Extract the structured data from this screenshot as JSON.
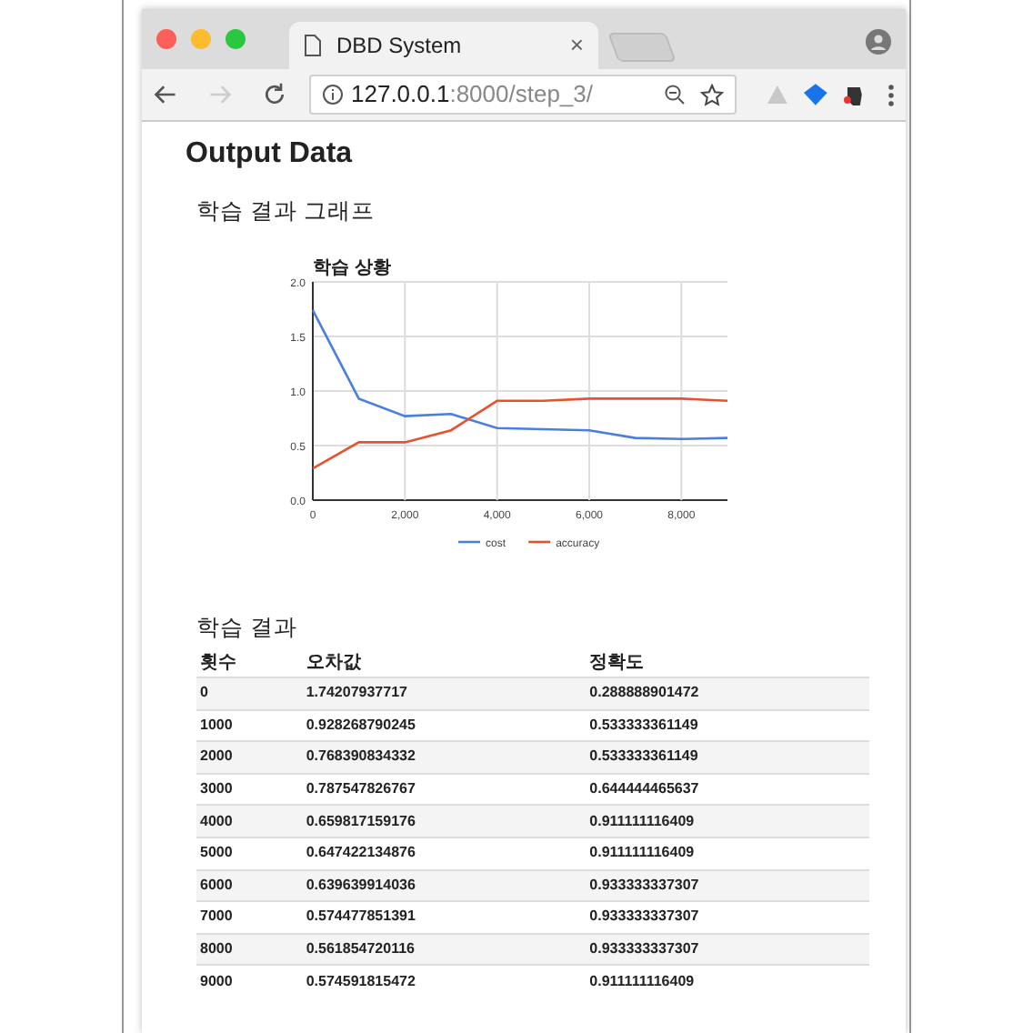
{
  "browser": {
    "tab_title": "DBD System",
    "tab_close": "×",
    "url": "**127.0.0.1**:8000/step_3/",
    "nav": [
      {
        "kind": "back",
        "disabled": false
      },
      {
        "kind": "forward",
        "disabled": true
      },
      {
        "kind": "reload",
        "disabled": false
      }
    ]
  },
  "page": {
    "title": "Output Data",
    "graph_heading": "학습 결과 그래프",
    "chart_data": {
      "type": "line",
      "title": "학습 상황",
      "x": [
        0,
        1000,
        2000,
        3000,
        4000,
        5000,
        6000,
        7000,
        8000,
        9000
      ],
      "series": [
        {
          "name": "cost",
          "color": "#4a7fe0",
          "values": [
            1.74,
            0.93,
            0.77,
            0.79,
            0.66,
            0.65,
            0.64,
            0.57,
            0.56,
            0.57
          ]
        },
        {
          "name": "accuracy",
          "color": "#e8502e",
          "values": [
            0.29,
            0.53,
            0.53,
            0.64,
            0.91,
            0.91,
            0.93,
            0.93,
            0.93,
            0.91
          ]
        }
      ],
      "xlim": [
        0,
        9000
      ],
      "ylim": [
        0,
        2
      ],
      "grid": true,
      "legend": true,
      "xticks": [
        {
          "value": 0,
          "label": "0"
        },
        {
          "value": 2000,
          "label": "2,000"
        },
        {
          "value": 4000,
          "label": "4,000"
        },
        {
          "value": 6000,
          "label": "6,000"
        },
        {
          "value": 8000,
          "label": "8,000"
        }
      ],
      "yticks": [
        {
          "value": 0,
          "label": "0.0"
        },
        {
          "value": 0.5,
          "label": "0.5"
        },
        {
          "value": 1,
          "label": "1.0"
        },
        {
          "value": 1.5,
          "label": "1.5"
        },
        {
          "value": 2,
          "label": "2.0"
        }
      ]
    },
    "table_heading": "학습 결과",
    "table": {
      "columns": [
        "횟수",
        "오차값",
        "정확도"
      ],
      "rows": [
        [
          "0",
          "1.74207937717",
          "0.288888901472"
        ],
        [
          "1000",
          "0.928268790245",
          "0.533333361149"
        ],
        [
          "2000",
          "0.768390834332",
          "0.533333361149"
        ],
        [
          "3000",
          "0.787547826767",
          "0.644444465637"
        ],
        [
          "4000",
          "0.659817159176",
          "0.911111116409"
        ],
        [
          "5000",
          "0.647422134876",
          "0.911111116409"
        ],
        [
          "6000",
          "0.639639914036",
          "0.933333337307"
        ],
        [
          "7000",
          "0.574477851391",
          "0.933333337307"
        ],
        [
          "8000",
          "0.561854720116",
          "0.933333337307"
        ],
        [
          "9000",
          "0.574591815472",
          "0.911111116409"
        ]
      ]
    }
  }
}
